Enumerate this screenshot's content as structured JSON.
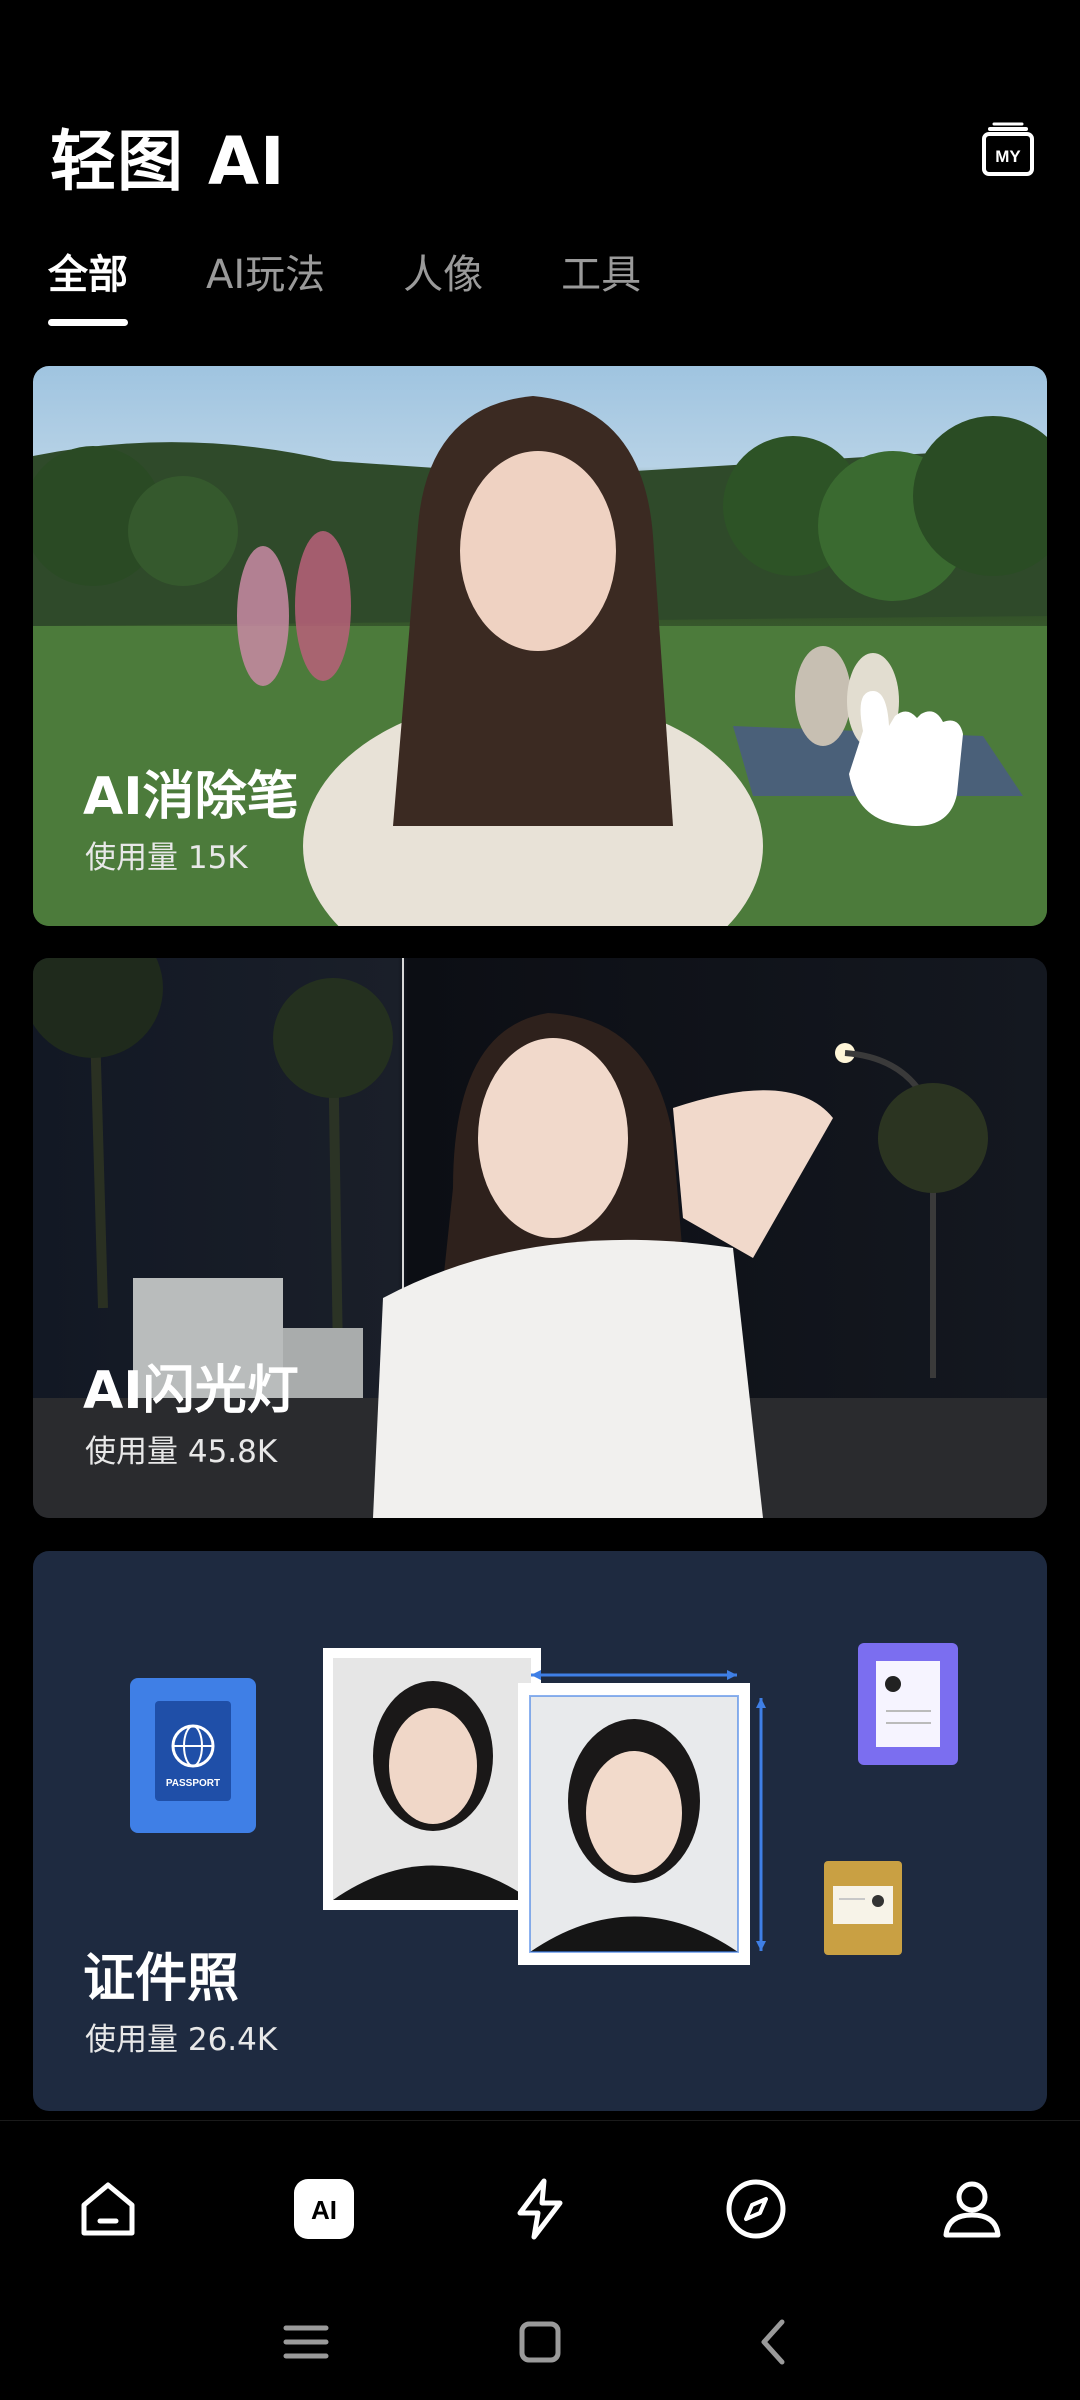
{
  "header": {
    "title": "轻图 AI",
    "my_label": "MY"
  },
  "tabs": [
    {
      "label": "全部",
      "active": true
    },
    {
      "label": "AI玩法",
      "active": false
    },
    {
      "label": "人像",
      "active": false
    },
    {
      "label": "工具",
      "active": false
    }
  ],
  "cards": [
    {
      "title": "AI消除笔",
      "usage": "使用量 15K"
    },
    {
      "title": "AI闪光灯",
      "usage": "使用量 45.8K"
    },
    {
      "title": "证件照",
      "usage": "使用量 26.4K",
      "passport_label": "PASSPORT"
    }
  ],
  "bottom_nav": [
    {
      "icon": "home-icon"
    },
    {
      "icon": "ai-icon",
      "label": "AI",
      "active": true
    },
    {
      "icon": "lightning-icon"
    },
    {
      "icon": "compass-icon"
    },
    {
      "icon": "profile-icon"
    }
  ],
  "system_nav": [
    {
      "icon": "menu-icon"
    },
    {
      "icon": "home-square-icon"
    },
    {
      "icon": "back-icon"
    }
  ],
  "colors": {
    "background": "#000000",
    "card3_bg": "#1e2a40",
    "passport_blue": "#3f7fe6",
    "doc_purple": "#7b6ef0",
    "card_gold": "#c9a043"
  }
}
